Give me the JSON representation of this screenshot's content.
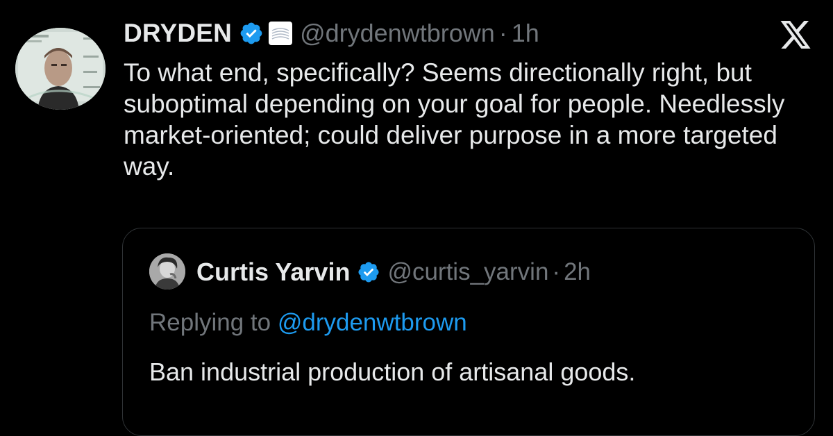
{
  "tweet": {
    "author": {
      "name": "DRYDEN",
      "handle": "@drydenwtbrown",
      "separator": "·",
      "time": "1h",
      "avatar_icon": "profile-photo"
    },
    "text": "To what end, specifically? Seems directionally right, but suboptimal depending on your goal for people. Needlessly market-oriented; could deliver purpose in a more targeted way."
  },
  "quoted": {
    "author": {
      "name": "Curtis Yarvin",
      "handle": "@curtis_yarvin",
      "separator": "·",
      "time": "2h",
      "avatar_icon": "profile-photo"
    },
    "replying_prefix": "Replying to",
    "replying_to": "@drydenwtbrown",
    "text": "Ban industrial production of artisanal goods."
  },
  "icons": {
    "verified": "verified-badge-icon",
    "affiliation": "affiliation-badge-icon",
    "brand": "x-logo-icon"
  },
  "colors": {
    "background": "#000000",
    "text": "#e7e9ea",
    "muted": "#71767b",
    "accent": "#1d9bf0",
    "border": "#2f3336"
  }
}
